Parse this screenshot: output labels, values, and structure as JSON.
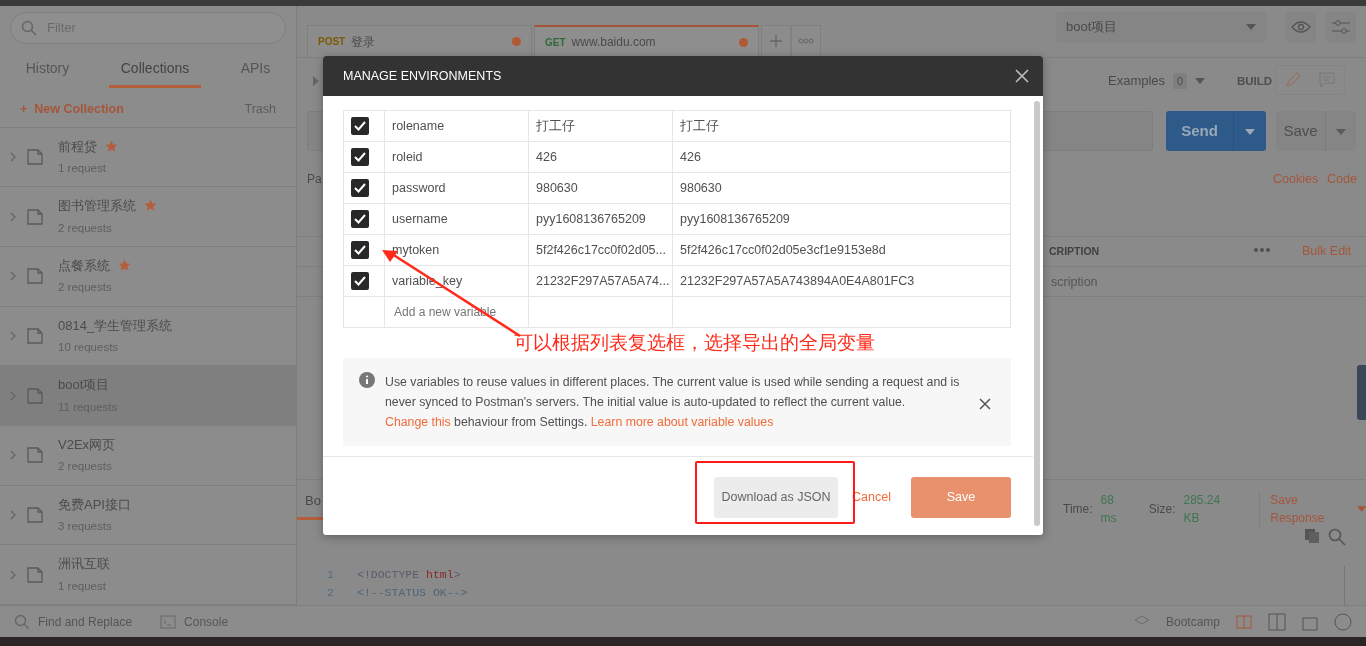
{
  "sidebar": {
    "search": {
      "placeholder": "Filter"
    },
    "tabs": [
      {
        "label": "History",
        "selected": false
      },
      {
        "label": "Collections",
        "selected": true
      },
      {
        "label": "APIs",
        "selected": false
      }
    ],
    "new_collection": {
      "icon": "+",
      "label": "New Collection"
    },
    "trash": "Trash",
    "collections": [
      {
        "name": "前程贷",
        "count": "1 request",
        "starred": true,
        "selected": false
      },
      {
        "name": "图书管理系统",
        "count": "2 requests",
        "starred": true,
        "selected": false
      },
      {
        "name": "点餐系统",
        "count": "2 requests",
        "starred": true,
        "selected": false
      },
      {
        "name": "0814_学生管理系统",
        "count": "10 requests",
        "starred": false,
        "selected": false
      },
      {
        "name": "boot项目",
        "count": "11 requests",
        "starred": false,
        "selected": true
      },
      {
        "name": "V2Ex网页",
        "count": "2 requests",
        "starred": false,
        "selected": false
      },
      {
        "name": "免费API接口",
        "count": "3 requests",
        "starred": false,
        "selected": false
      },
      {
        "name": "洲讯互联",
        "count": "1 request",
        "starred": false,
        "selected": false
      }
    ]
  },
  "request_tabs": [
    {
      "method": "POST",
      "title": "登录",
      "selected": false,
      "unsaved": true
    },
    {
      "method": "GET",
      "title": "www.baidu.com",
      "selected": true,
      "unsaved": true
    }
  ],
  "environment": {
    "value": "boot项目"
  },
  "toolbar": {
    "examples": "Examples",
    "examples_count": "0",
    "build": "BUILD"
  },
  "request": {
    "send": "Send",
    "save": "Save",
    "cookies": "Cookies",
    "code": "Code",
    "params_fragment": "Pa",
    "column_fragment": "CRIPTION",
    "bulk_edit": "Bulk Edit",
    "description_fragment": "scription"
  },
  "response": {
    "tab_fragment": "Bo",
    "time_label": "Time:",
    "time": "68 ms",
    "size_label": "Size:",
    "size": "285.24 KB",
    "save_response": "Save Response",
    "code_lines": [
      {
        "number": "1",
        "parts": [
          {
            "text": "<!DOCTYPE ",
            "kind": "tag"
          },
          {
            "text": "html",
            "kind": "keyword"
          },
          {
            "text": ">",
            "kind": "tag"
          }
        ]
      },
      {
        "number": "2",
        "parts": [
          {
            "text": "<!--STATUS OK-->",
            "kind": "comment"
          }
        ]
      }
    ]
  },
  "footer": {
    "find": "Find and Replace",
    "console": "Console",
    "bootcamp": "Bootcamp"
  },
  "modal": {
    "title": "MANAGE ENVIRONMENTS",
    "variables": [
      {
        "checked": true,
        "key": "rolename",
        "initial": "打工仔",
        "current": "打工仔"
      },
      {
        "checked": true,
        "key": "roleid",
        "initial": "426",
        "current": "426"
      },
      {
        "checked": true,
        "key": "password",
        "initial": "980630",
        "current": "980630"
      },
      {
        "checked": true,
        "key": "username",
        "initial": "pyy1608136765209",
        "current": "pyy1608136765209"
      },
      {
        "checked": true,
        "key": "mytoken",
        "initial": "5f2f426c17cc0f02d05...",
        "current": "5f2f426c17cc0f02d05e3cf1e9153e8d"
      },
      {
        "checked": true,
        "key": "variable_key",
        "initial": "21232F297A57A5A74...",
        "current": "21232F297A57A5A743894A0E4A801FC3"
      }
    ],
    "new_placeholder": "Add a new variable",
    "info": {
      "text": "Use variables to reuse values in different places. The current value is used while sending a request and is never synced to Postman's servers. The initial value is auto-updated to reflect the current value.",
      "link_change": "Change this",
      "middle": "behaviour from Settings.",
      "link_learn": "Learn more about variable values"
    },
    "download": "Download as JSON",
    "cancel": "Cancel",
    "save": "Save"
  },
  "annotation": {
    "text": "可以根据列表复选框，选择导出的全局变量"
  }
}
